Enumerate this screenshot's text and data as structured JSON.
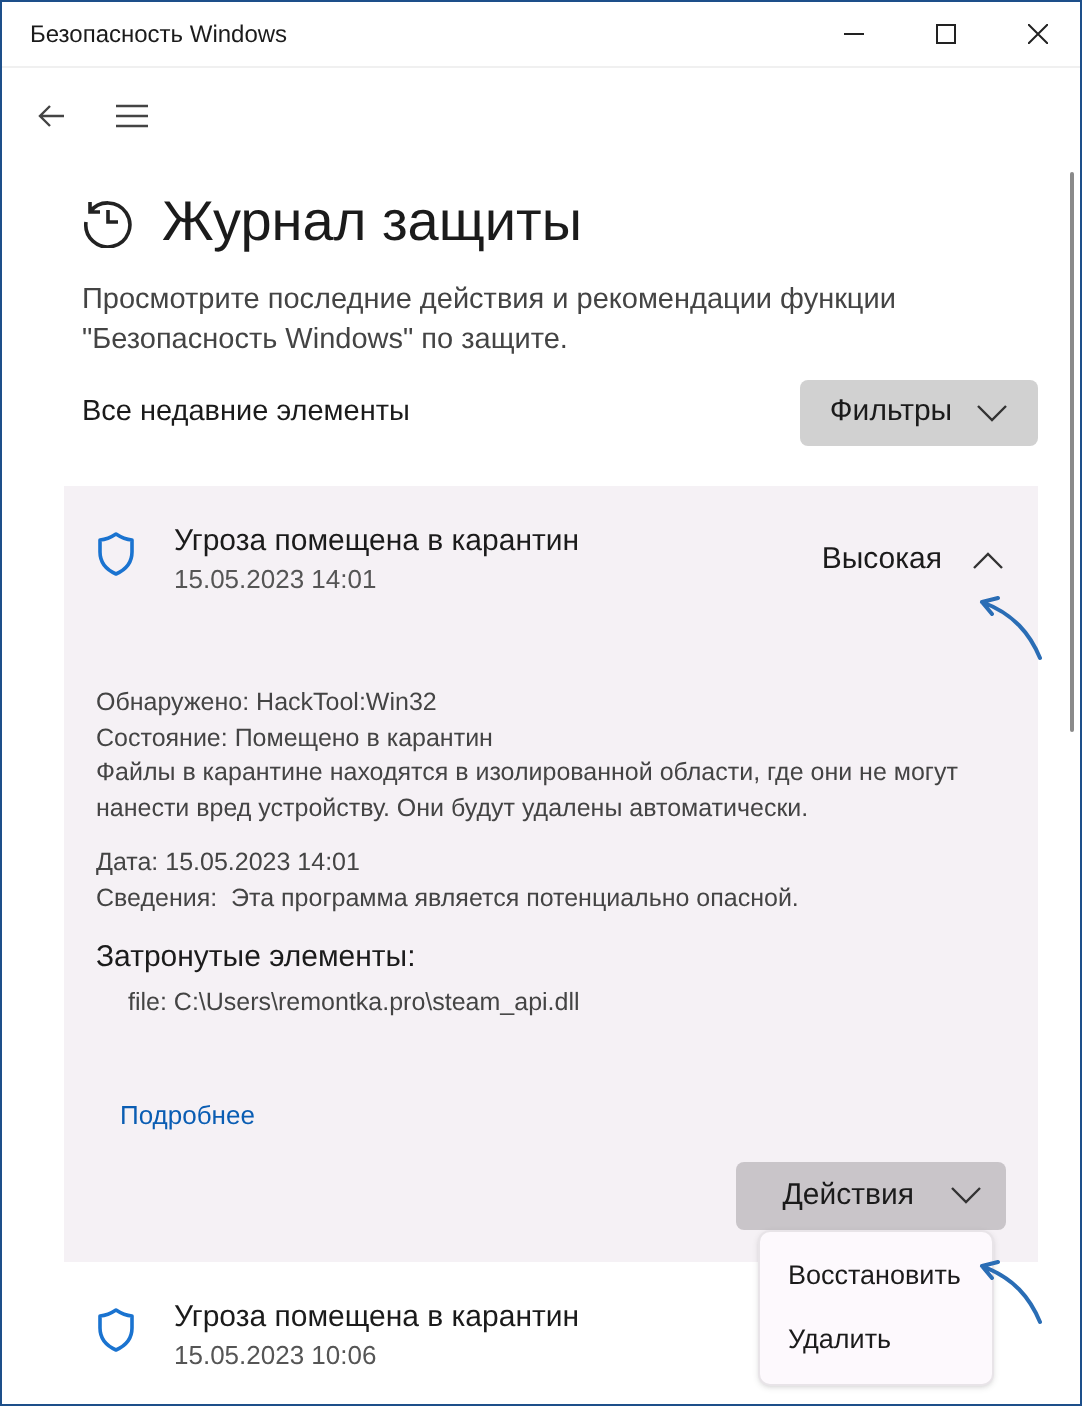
{
  "window": {
    "title": "Безопасность Windows"
  },
  "page": {
    "title": "Журнал защиты",
    "description": "Просмотрите последние действия и рекомендации функции \"Безопасность Windows\" по защите.",
    "section_label": "Все недавние элементы",
    "filter_button": "Фильтры"
  },
  "items": [
    {
      "title": "Угроза помещена в карантин",
      "date": "15.05.2023 14:01",
      "severity": "Высокая",
      "expanded": true,
      "details": [
        {
          "lines": [
            "Обнаружено: HackTool:Win32",
            "Состояние: Помещено в карантин",
            "Файлы в карантине находятся в изолированной области, где они не могут нанести вред устройству. Они будут удалены автоматически."
          ]
        },
        {
          "lines": [
            "Дата: 15.05.2023 14:01",
            "Сведения:  Эта программа является потенциально опасной."
          ]
        }
      ],
      "affected_heading": "Затронутые элементы:",
      "affected": [
        "file: C:\\Users\\remontka.pro\\steam_api.dll"
      ],
      "link": "Подробнее",
      "actions_button": "Действия",
      "actions_menu": [
        "Восстановить",
        "Удалить"
      ]
    },
    {
      "title": "Угроза помещена в карантин",
      "date": "15.05.2023 10:06",
      "expanded": false
    }
  ]
}
